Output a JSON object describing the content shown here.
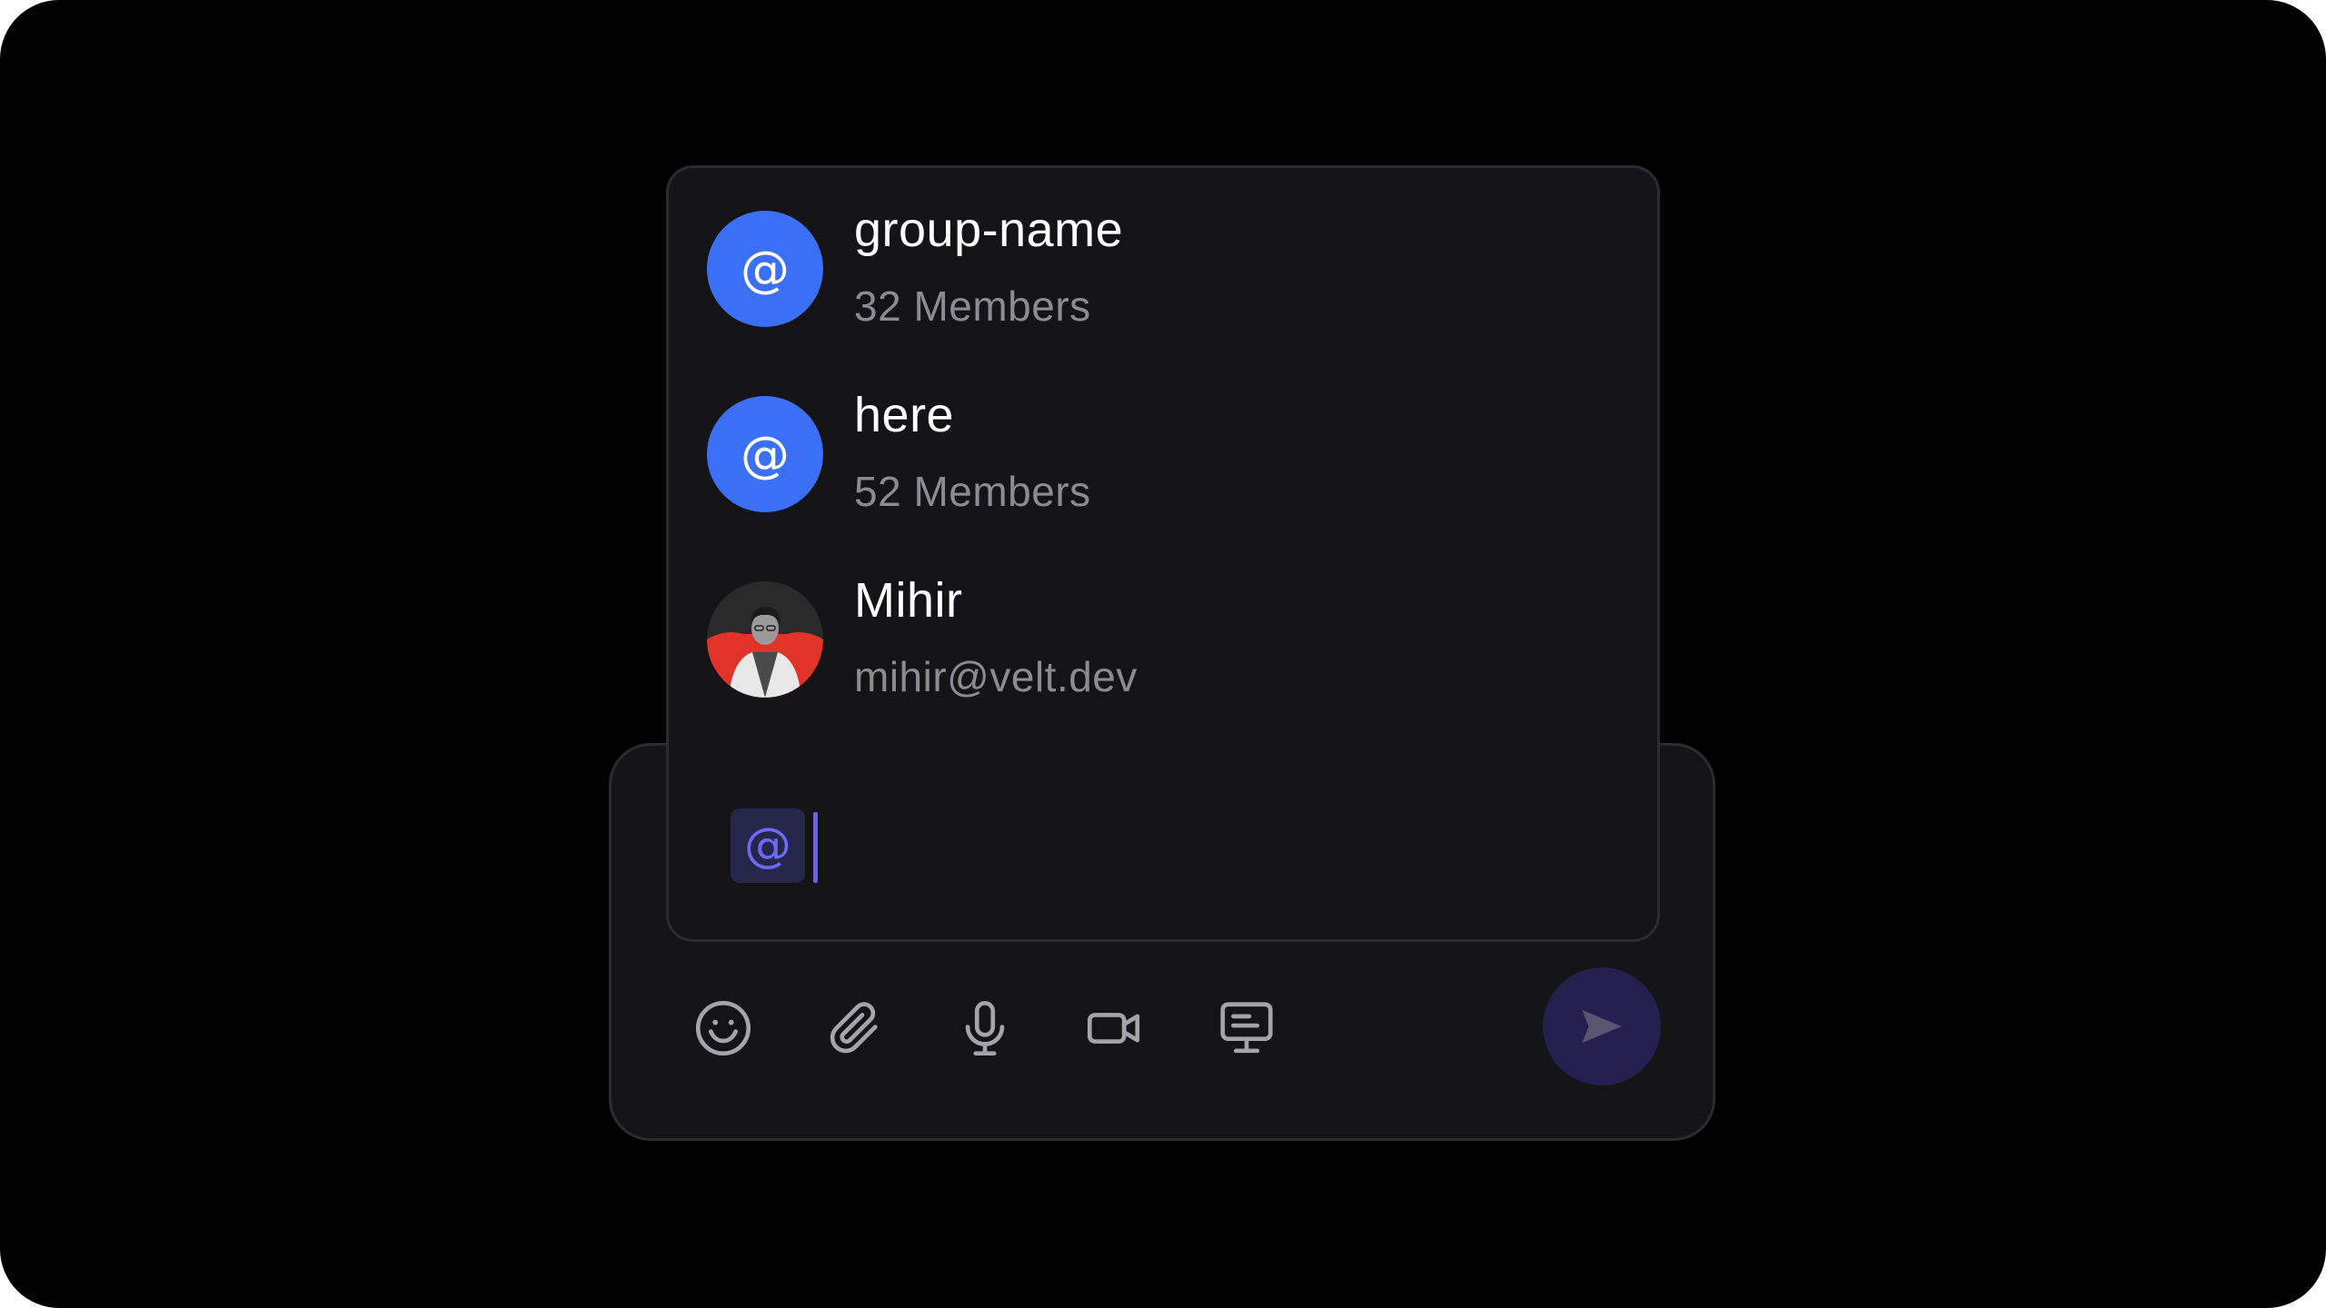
{
  "mention_list": {
    "items": [
      {
        "name": "group-name",
        "subtitle": "32 Members",
        "avatar": "at-icon"
      },
      {
        "name": "here",
        "subtitle": "52 Members",
        "avatar": "at-icon"
      },
      {
        "name": "Mihir",
        "subtitle": "mihir@velt.dev",
        "avatar": "user-photo"
      }
    ]
  },
  "composer": {
    "chip_text": "@",
    "toolbar_icons": [
      "emoji-icon",
      "attachment-icon",
      "microphone-icon",
      "video-icon",
      "screen-share-icon"
    ],
    "send_icon": "send-icon"
  },
  "colors": {
    "background": "#000000",
    "panel": "#141416",
    "border": "#2c2c30",
    "accent_blue": "#3b6ff5",
    "caret": "#6c5cf5",
    "send_button": "#23204f",
    "icon_gray": "#a4a4ad",
    "subtitle_gray": "#8b8b93"
  }
}
